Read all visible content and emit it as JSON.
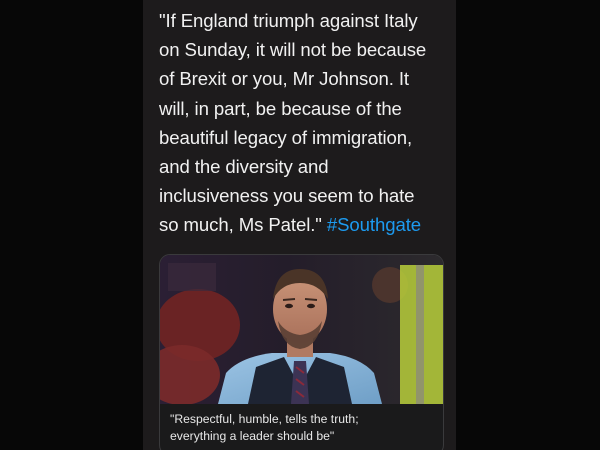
{
  "tweet": {
    "text": "\"If England triumph against Italy\non Sunday, it will not be because\nof Brexit or you, Mr Johnson. It\nwill, in part, be because of the\nbeautiful legacy of immigration,\nand the diversity and\ninclusiveness you seem to hate\nso much, Ms Patel.\" ",
    "hashtag": "#Southgate"
  },
  "card": {
    "image_subject": "man-in-waistcoat-photo",
    "caption": "\"Respectful, humble, tells the truth;\neverything a leader should be\""
  },
  "colors": {
    "background": "#0b0b0c",
    "panel": "#1d1b1c",
    "text": "#f1f1f1",
    "hashtag": "#1d9bf0",
    "card_border": "#3a3a3c"
  }
}
